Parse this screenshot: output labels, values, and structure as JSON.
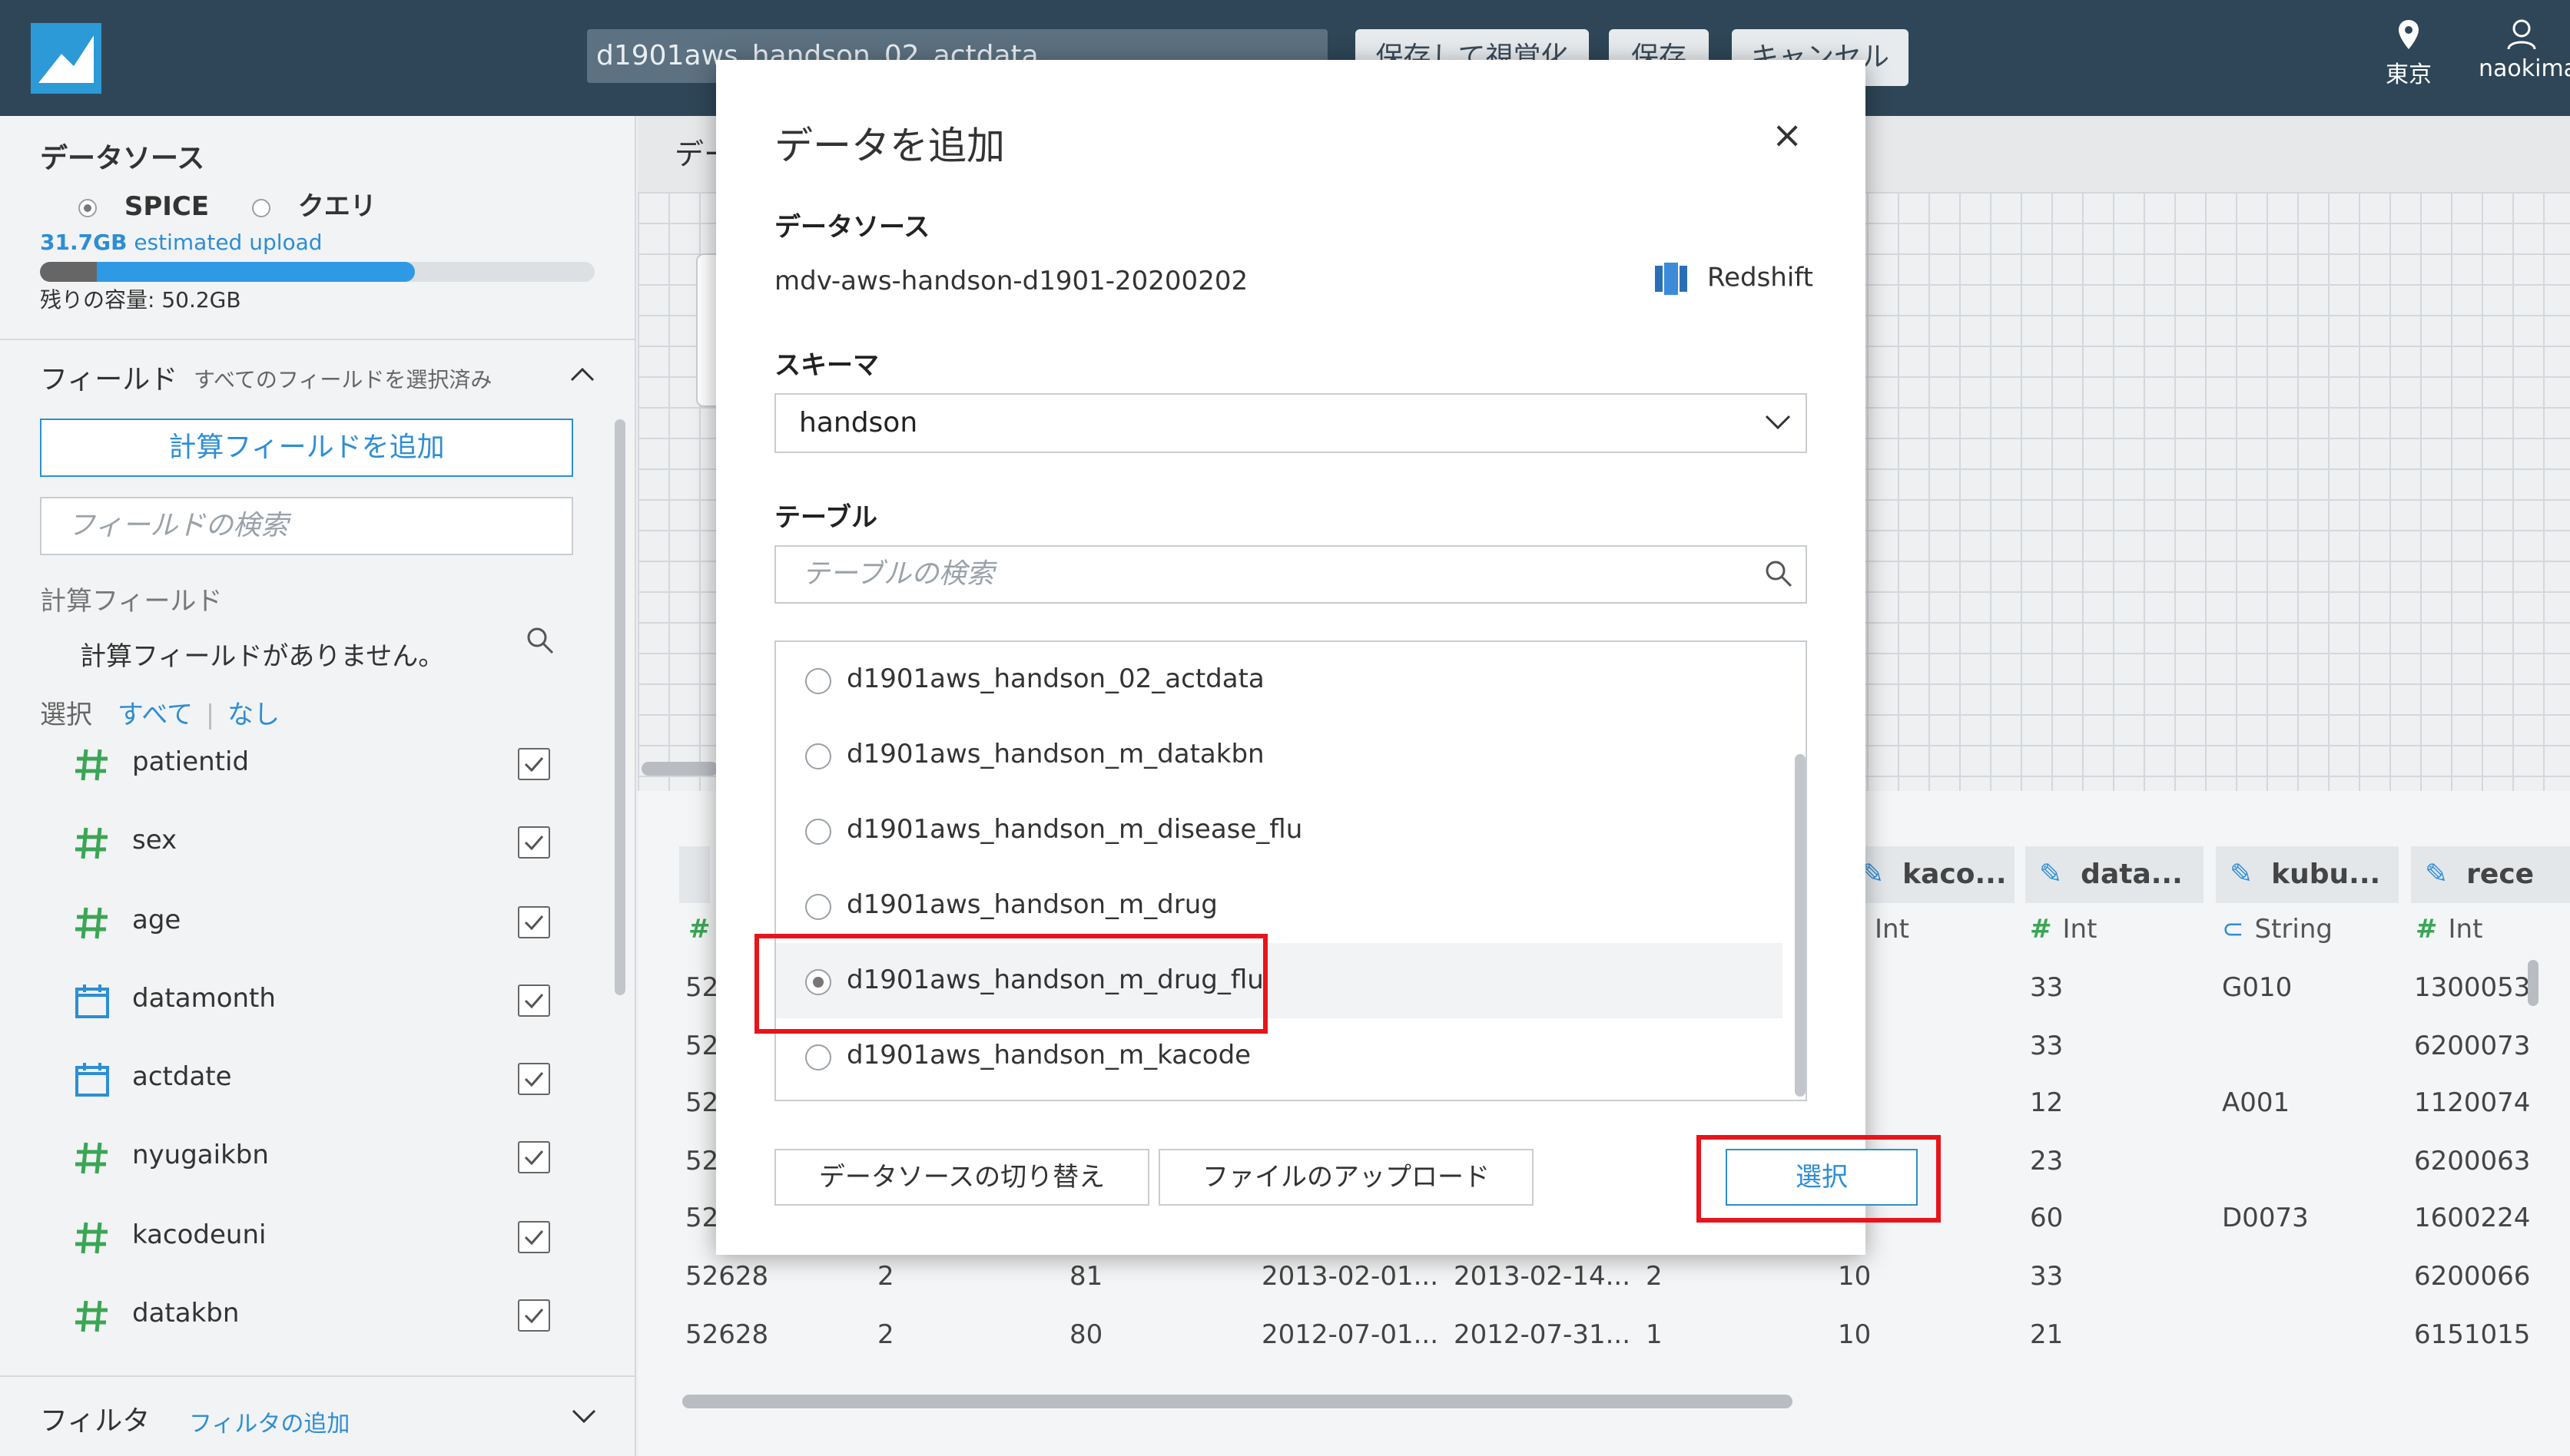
{
  "topbar": {
    "title_value": "d1901aws_handson_02_actdata",
    "save_visualize_label": "保存して視覚化",
    "save_label": "保存",
    "cancel_label": "キャンセル",
    "region_label": "東京",
    "user_label": "naokima"
  },
  "left_panel": {
    "datasource_title": "データソース",
    "mode_spice": "SPICE",
    "mode_query": "クエリ",
    "upload_size": "31.7GB",
    "upload_text": "estimated upload",
    "remaining_text": "残りの容量: 50.2GB",
    "fields_title": "フィールド",
    "fields_subtitle": "すべてのフィールドを選択済み",
    "add_calc_field_label": "計算フィールドを追加",
    "field_search_placeholder": "フィールドの検索",
    "calc_fields_title": "計算フィールド",
    "no_calc_fields": "計算フィールドがありません。",
    "select_label": "選択",
    "select_all": "すべて",
    "select_none": "なし",
    "fields": [
      {
        "name": "patientid",
        "icon": "number-icon"
      },
      {
        "name": "sex",
        "icon": "number-icon"
      },
      {
        "name": "age",
        "icon": "number-icon"
      },
      {
        "name": "datamonth",
        "icon": "calendar-icon"
      },
      {
        "name": "actdate",
        "icon": "calendar-icon"
      },
      {
        "name": "nyugaikbn",
        "icon": "number-icon"
      },
      {
        "name": "kacodeuni",
        "icon": "number-icon"
      },
      {
        "name": "datakbn",
        "icon": "number-icon"
      }
    ],
    "filter_title": "フィルタ",
    "filter_add": "フィルタの追加"
  },
  "main": {
    "tab_label": "デー",
    "columns": [
      {
        "label": "kaco...",
        "type": "Int",
        "type_icon": "number-icon"
      },
      {
        "label": "data...",
        "type": "Int",
        "type_icon": "number-icon"
      },
      {
        "label": "kubu...",
        "type": "String",
        "type_icon": "string-icon"
      },
      {
        "label": "rece",
        "type": "Int",
        "type_icon": "number-icon"
      }
    ],
    "first_type_icon": "#",
    "rows_left": [
      "52",
      "52",
      "52",
      "52",
      "52"
    ],
    "col_data": [
      "33",
      "33",
      "12",
      "23",
      "60"
    ],
    "col_kubu": [
      "G010",
      "",
      "A001",
      "",
      "D0073"
    ],
    "col_rece": [
      "1300053",
      "6200073",
      "1120074",
      "6200063",
      "1600224"
    ],
    "bottom_rows": [
      [
        "52628",
        "2",
        "81",
        "2013-02-01...",
        "2013-02-14...",
        "2",
        "10",
        "33",
        "",
        "6200066"
      ],
      [
        "52628",
        "2",
        "80",
        "2012-07-01...",
        "2012-07-31...",
        "1",
        "10",
        "21",
        "",
        "6151015"
      ]
    ]
  },
  "modal": {
    "title": "データを追加",
    "close": "×",
    "datasource_label": "データソース",
    "datasource_name": "mdv-aws-handson-d1901-20200202",
    "datasource_type": "Redshift",
    "schema_label": "スキーマ",
    "schema_value": "handson",
    "table_label": "テーブル",
    "table_search_placeholder": "テーブルの検索",
    "tables": [
      "d1901aws_handson_02_actdata",
      "d1901aws_handson_m_datakbn",
      "d1901aws_handson_m_disease_flu",
      "d1901aws_handson_m_drug",
      "d1901aws_handson_m_drug_flu",
      "d1901aws_handson_m_kacode"
    ],
    "selected_index": 4,
    "switch_source_label": "データソースの切り替え",
    "upload_file_label": "ファイルのアップロード",
    "select_label": "選択"
  },
  "colors": {
    "topbar": "#2e4657",
    "accent": "#2d8ed5",
    "number_icon": "#3aa655",
    "highlight": "#e8141b"
  }
}
